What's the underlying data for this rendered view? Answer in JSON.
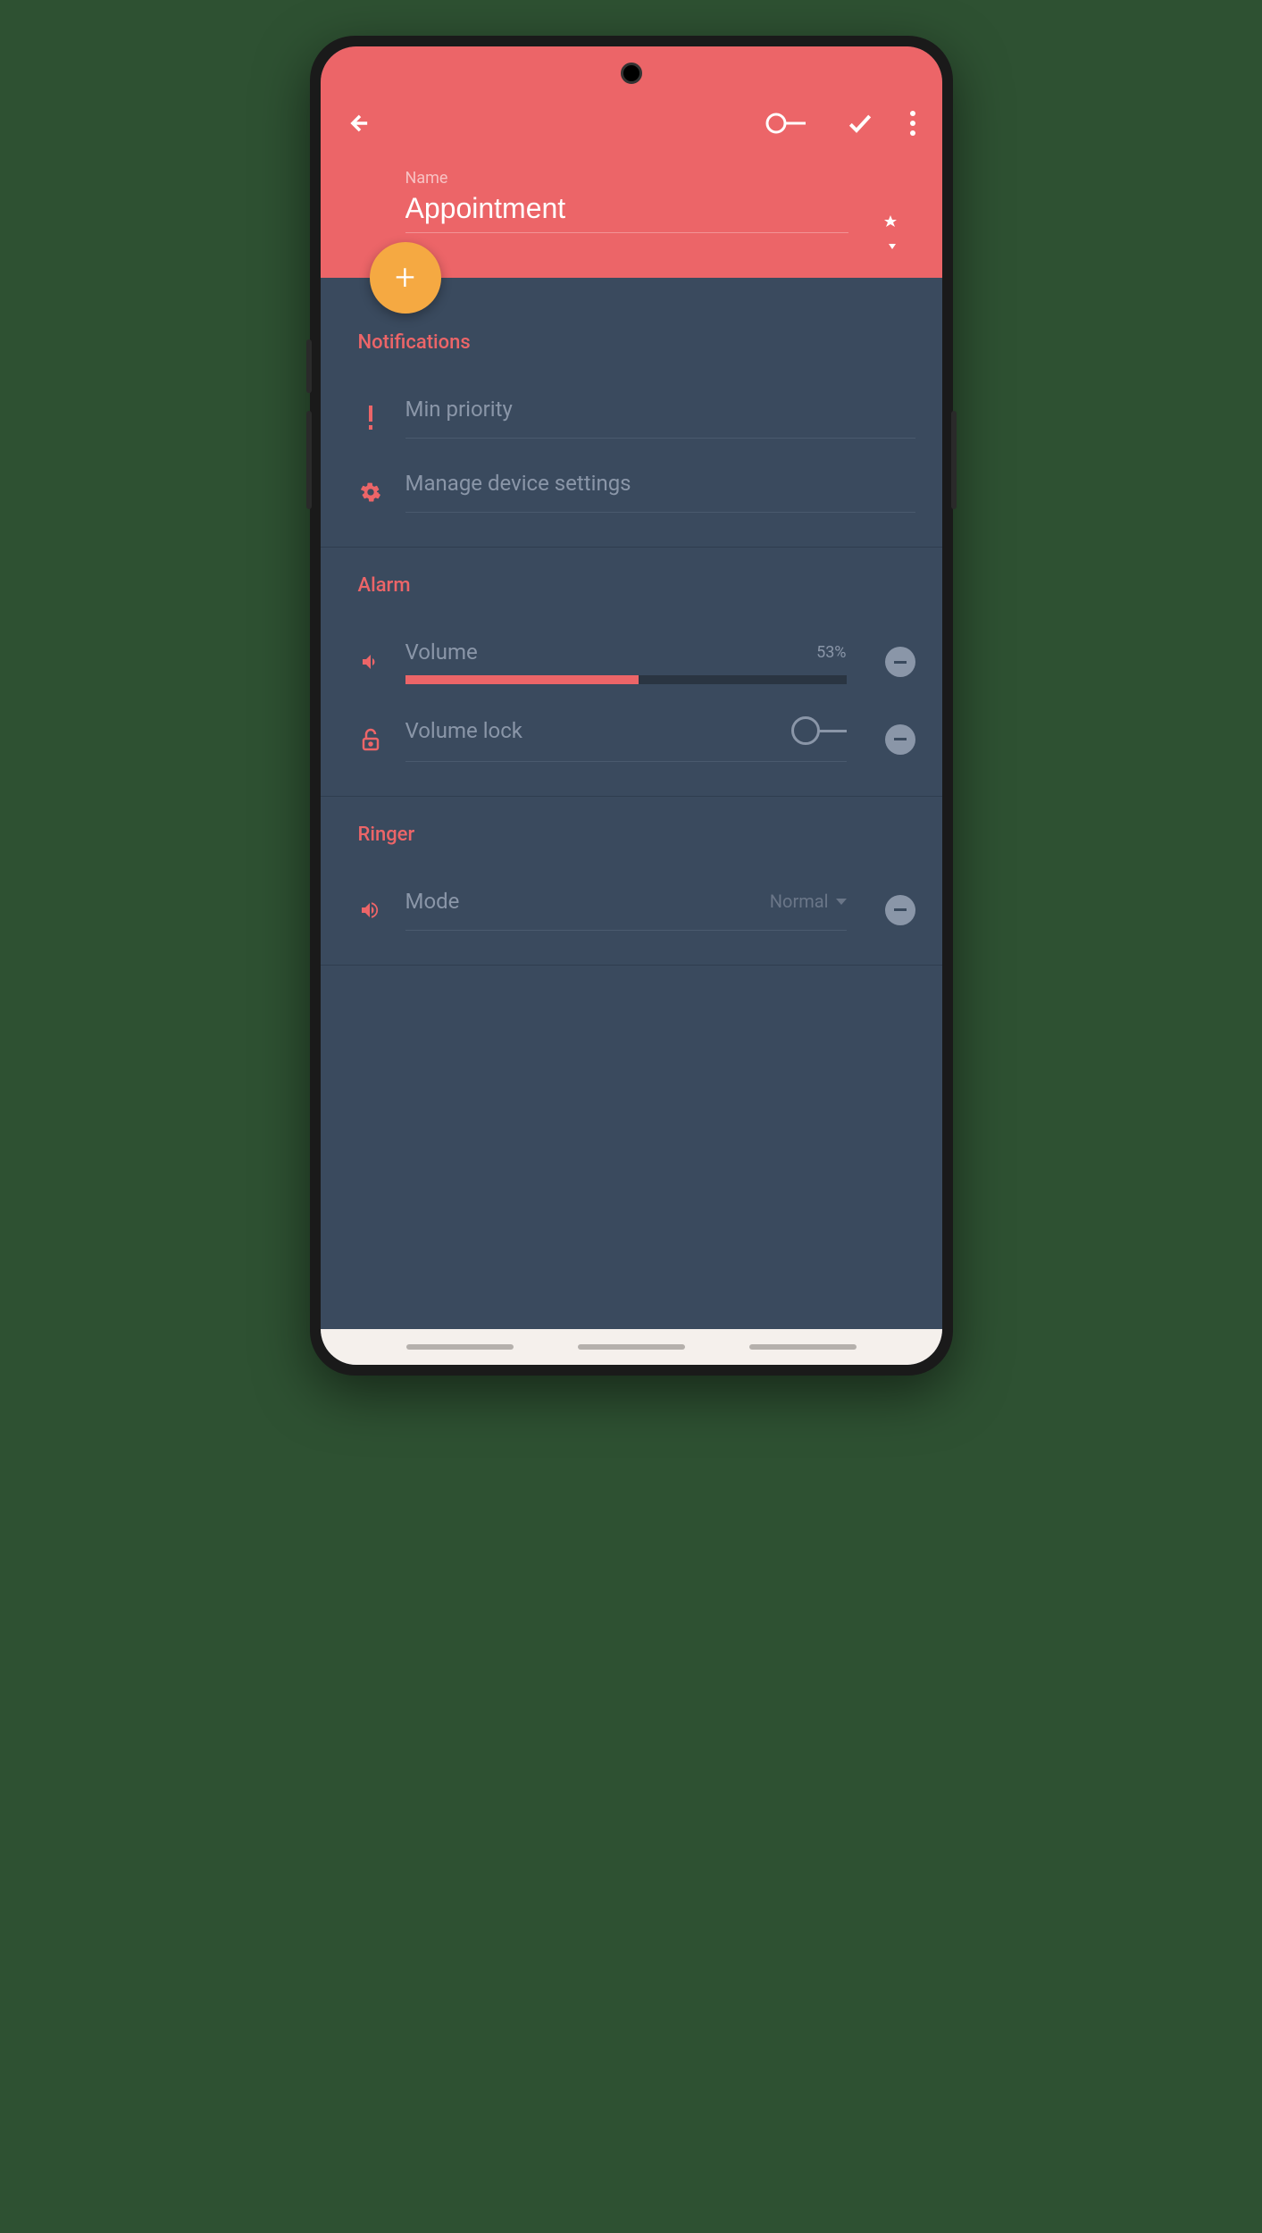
{
  "header": {
    "name_label": "Name",
    "name_value": "Appointment"
  },
  "sections": {
    "notifications": {
      "title": "Notifications",
      "min_priority": "Min priority",
      "manage_settings": "Manage device settings"
    },
    "alarm": {
      "title": "Alarm",
      "volume_label": "Volume",
      "volume_percent": "53%",
      "volume_value": 53,
      "volume_lock": "Volume lock"
    },
    "ringer": {
      "title": "Ringer",
      "mode_label": "Mode",
      "mode_value": "Normal"
    }
  }
}
